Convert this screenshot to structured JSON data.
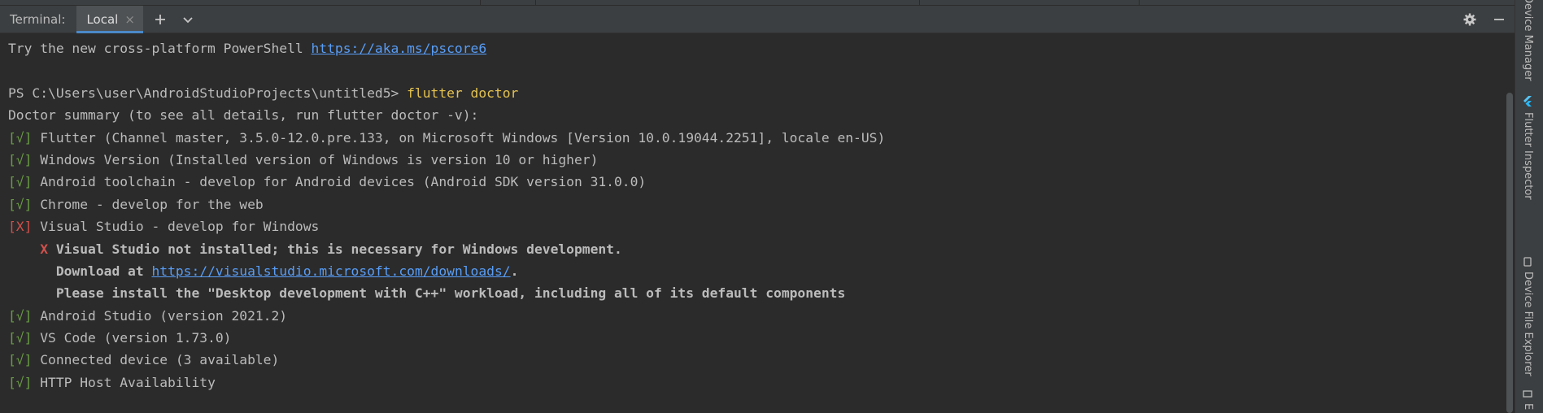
{
  "header": {
    "title": "Terminal:",
    "tab_label": "Local",
    "tab_close": "×",
    "add_tab": "+",
    "more_tabs": "⌄"
  },
  "right_tools": [
    {
      "label": "Device Manager"
    },
    {
      "label": "Flutter Inspector"
    },
    {
      "label": "Device File Explorer"
    },
    {
      "label": "E"
    }
  ],
  "terminal": {
    "intro_text": "Try the new cross-platform PowerShell ",
    "intro_link": "https://aka.ms/pscore6",
    "prompt": "PS C:\\Users\\user\\AndroidStudioProjects\\untitled5> ",
    "command": "flutter doctor",
    "summary": "Doctor summary (to see all details, run flutter doctor -v):",
    "checks": [
      {
        "mark": "[√]",
        "status": "ok",
        "text": " Flutter (Channel master, 3.5.0-12.0.pre.133, on Microsoft Windows [Version 10.0.19044.2251], locale en-US)"
      },
      {
        "mark": "[√]",
        "status": "ok",
        "text": " Windows Version (Installed version of Windows is version 10 or higher)"
      },
      {
        "mark": "[√]",
        "status": "ok",
        "text": " Android toolchain - develop for Android devices (Android SDK version 31.0.0)"
      },
      {
        "mark": "[√]",
        "status": "ok",
        "text": " Chrome - develop for the web"
      },
      {
        "mark": "[X]",
        "status": "error",
        "text": " Visual Studio - develop for Windows"
      }
    ],
    "vs_error": {
      "mark": "X",
      "message": " Visual Studio not installed; this is necessary for Windows development.",
      "download_prefix": "Download at ",
      "download_link": "https://visualstudio.microsoft.com/downloads/",
      "download_suffix": ".",
      "install_hint": "Please install the \"Desktop development with C++\" workload, including all of its default components"
    },
    "checks_after": [
      {
        "mark": "[√]",
        "status": "ok",
        "text": " Android Studio (version 2021.2)"
      },
      {
        "mark": "[√]",
        "status": "ok",
        "text": " VS Code (version 1.73.0)"
      },
      {
        "mark": "[√]",
        "status": "ok",
        "text": " Connected device (3 available)"
      },
      {
        "mark": "[√]",
        "status": "ok",
        "text": " HTTP Host Availability"
      }
    ]
  },
  "colors": {
    "background": "#2b2b2b",
    "toolbar": "#3c3f41",
    "text": "#bbbbbb",
    "link": "#589df6",
    "command": "#e4c24f",
    "ok": "#6a9c45",
    "error": "#d1514c",
    "tab_underline": "#4a88c7"
  },
  "icons": {
    "settings": "gear-icon",
    "minimize": "minimize-icon",
    "add": "plus-icon",
    "more": "chevron-down-icon",
    "close": "close-icon"
  }
}
